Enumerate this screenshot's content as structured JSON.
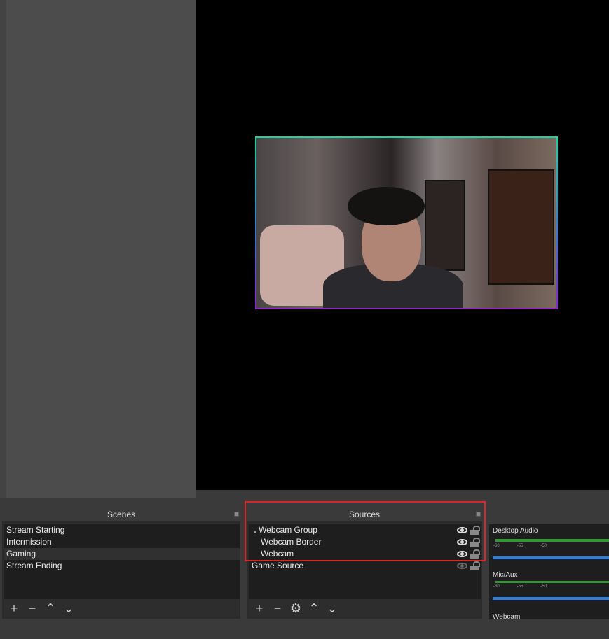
{
  "scenes": {
    "title": "Scenes",
    "items": [
      {
        "label": "Stream Starting"
      },
      {
        "label": "Intermission"
      },
      {
        "label": "Gaming",
        "selected": true
      },
      {
        "label": "Stream Ending"
      }
    ]
  },
  "sources": {
    "title": "Sources",
    "items": [
      {
        "label": "Webcam Group",
        "group": true,
        "expanded": true,
        "visible": true,
        "locked": false
      },
      {
        "label": "Webcam Border",
        "visible": true,
        "locked": false
      },
      {
        "label": "Webcam",
        "visible": true,
        "locked": false
      },
      {
        "label": "Game Source",
        "visible": false,
        "locked": false
      }
    ]
  },
  "mixer": {
    "channels": [
      {
        "label": "Desktop Audio",
        "ticks": [
          "-60",
          "-55",
          "-50"
        ]
      },
      {
        "label": "Mic/Aux",
        "ticks": [
          "-60",
          "-55",
          "-50"
        ]
      },
      {
        "label": "Webcam"
      }
    ]
  },
  "colors": {
    "highlight": "#d9262c",
    "meter": "#2f9a2f",
    "volume": "#2f7ed8"
  }
}
